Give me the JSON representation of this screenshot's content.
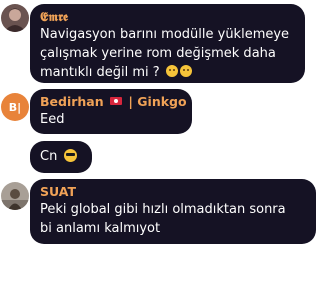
{
  "messages": [
    {
      "author": "𝕰𝖒𝖗𝖊",
      "lines": [
        "Navigasyon barını modülle yüklemeye",
        "çalışmak yerine rom değişmek daha",
        "mantıklı değil mi ?"
      ],
      "trailing_icons": [
        "upside-down-face-icon",
        "thinking-face-icon"
      ]
    },
    {
      "author_name": "Bedirhan",
      "author_flag_icon": "turkey-flag-icon",
      "author_separator": "|",
      "author_tag": "Ginkgo",
      "avatar_initials": "B|",
      "avatar_color": "#e8833a",
      "lines": [
        "Eed"
      ]
    },
    {
      "lines": [
        "Cn"
      ],
      "trailing_icons": [
        "sunglasses-face-icon"
      ]
    },
    {
      "author": "SUAT",
      "lines": [
        "Peki global gibi hızlı olmadıktan sonra",
        "bi anlamı kalmıyot"
      ]
    }
  ],
  "colors": {
    "bubble": "#151224",
    "author_name": "#f0a257",
    "message_text": "#ffffff",
    "background": "#ffffff"
  }
}
